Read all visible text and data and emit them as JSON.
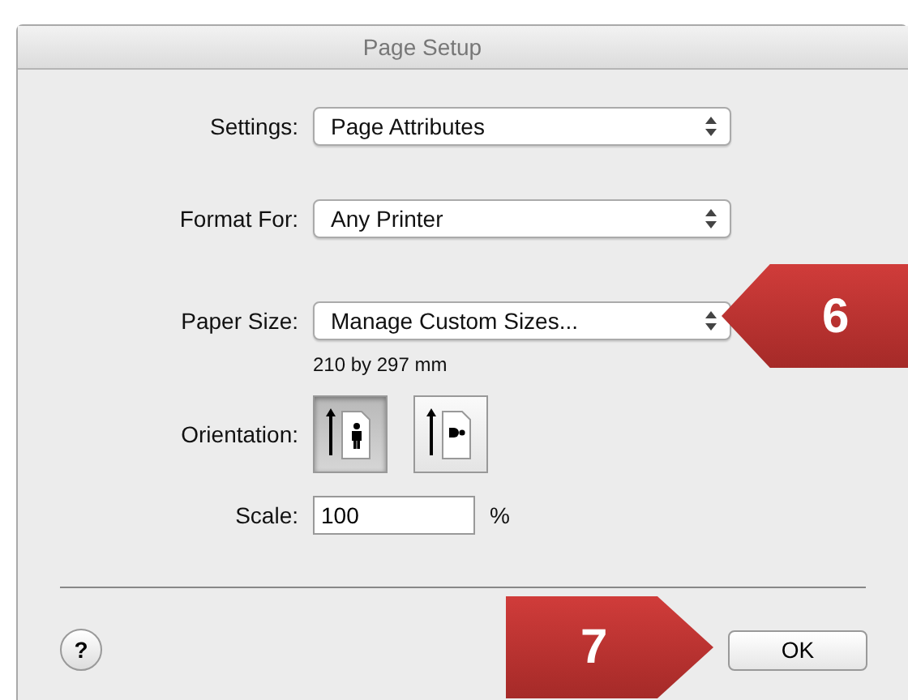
{
  "window": {
    "title": "Page Setup"
  },
  "popups": [
    {
      "label": "Settings:",
      "value": "Page Attributes"
    },
    {
      "label": "Format For:",
      "value": "Any Printer"
    },
    {
      "label": "Paper Size:",
      "value": "Manage Custom Sizes...",
      "note": "210 by 297 mm"
    }
  ],
  "orientation": {
    "label": "Orientation:",
    "options": [
      {
        "kind": "portrait",
        "selected": true
      },
      {
        "kind": "landscape",
        "selected": false
      }
    ]
  },
  "scale": {
    "label": "Scale:",
    "value": "100",
    "unit": "%"
  },
  "buttons": {
    "help": "?",
    "ok": "OK"
  },
  "callouts": [
    {
      "number": "6",
      "kind": "left"
    },
    {
      "number": "7",
      "kind": "right"
    }
  ]
}
